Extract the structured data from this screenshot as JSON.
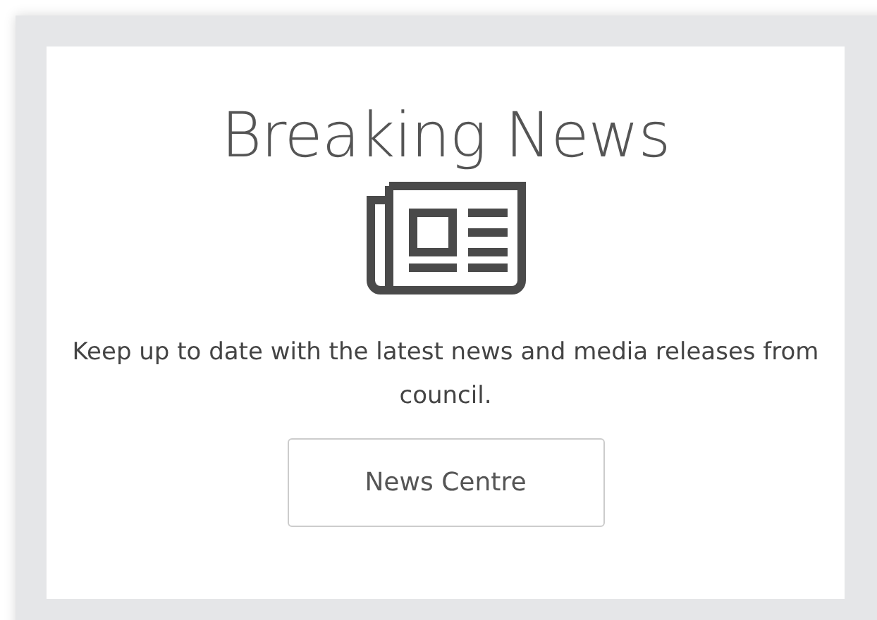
{
  "card": {
    "title": "Breaking News",
    "description": "Keep up to date with the latest news and media releases from council.",
    "button": "News Centre"
  }
}
